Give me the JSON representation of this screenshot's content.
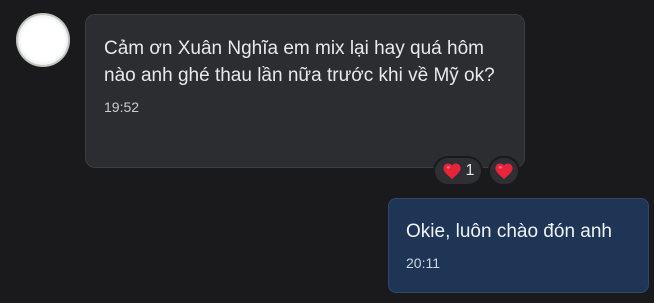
{
  "conversation": {
    "messages": [
      {
        "direction": "incoming",
        "text": "Cảm ơn Xuân Nghĩa em mix lại hay quá hôm nào anh ghé thau lần nữa trước khi về Mỹ ok?",
        "time": "19:52",
        "reactions": [
          {
            "icon": "heart-icon",
            "count": "1"
          },
          {
            "icon": "heart-icon",
            "count": ""
          }
        ]
      },
      {
        "direction": "outgoing",
        "text": "Okie, luôn chào đón anh",
        "time": "20:11"
      }
    ]
  },
  "colors": {
    "background": "#1a1a1d",
    "incoming_bubble": "#2b2d31",
    "outgoing_bubble": "#1f3556",
    "heart": "#e8243b"
  }
}
